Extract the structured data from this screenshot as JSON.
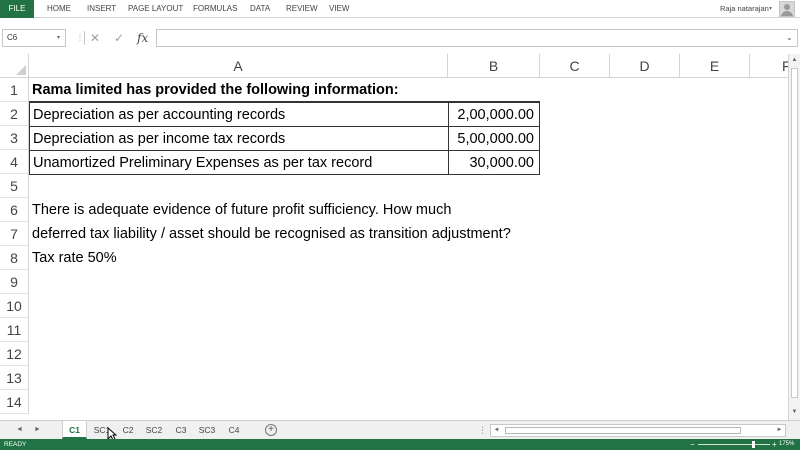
{
  "ribbon": {
    "file_tab": "FILE",
    "tabs": [
      "HOME",
      "INSERT",
      "PAGE LAYOUT",
      "FORMULAS",
      "DATA",
      "REVIEW",
      "VIEW"
    ],
    "user_name": "Raja natarajan",
    "user_caret": "▾",
    "avatar_icon": "user-avatar-icon"
  },
  "formula_bar": {
    "name_box": "C6",
    "name_box_caret": "▾",
    "cancel_icon": "✕",
    "enter_icon": "✓",
    "fx_icon": "fx",
    "formula_value": "",
    "expand_icon": "⌄"
  },
  "grid": {
    "columns": [
      "A",
      "B",
      "C",
      "D",
      "E",
      "F"
    ],
    "rows": [
      "1",
      "2",
      "3",
      "4",
      "5",
      "6",
      "7",
      "8",
      "9",
      "10",
      "11",
      "12",
      "13",
      "14"
    ],
    "cells": {
      "a1": "Rama limited has provided the following information:",
      "a2": "Depreciation as per accounting records",
      "b2": "2,00,000.00",
      "a3": "Depreciation as per income tax records",
      "b3": "5,00,000.00",
      "a4": "Unamortized Preliminary Expenses as per tax record",
      "b4": "30,000.00",
      "a6": "There is adequate evidence of future profit sufficiency. How much",
      "a7": "deferred tax liability / asset should be recognised as transition adjustment?",
      "a8": "Tax rate 50%"
    },
    "selected_cell": "C6"
  },
  "sheets": {
    "tabs": [
      "C1",
      "SC1",
      "C2",
      "SC2",
      "C3",
      "SC3",
      "C4"
    ],
    "active_tab": "C1",
    "add_sheet_icon": "+",
    "nav_prev": "◄",
    "nav_next": "►"
  },
  "scrollbars": {
    "up": "▲",
    "down": "▼",
    "left": "◄",
    "right": "►",
    "split": "⋮"
  },
  "status_bar": {
    "status": "READY",
    "zoom_minus": "−",
    "zoom_plus": "+",
    "zoom_level": "175%"
  },
  "colors": {
    "accent": "#217346",
    "gridline": "#d4d4d4",
    "header_text": "#444444"
  }
}
